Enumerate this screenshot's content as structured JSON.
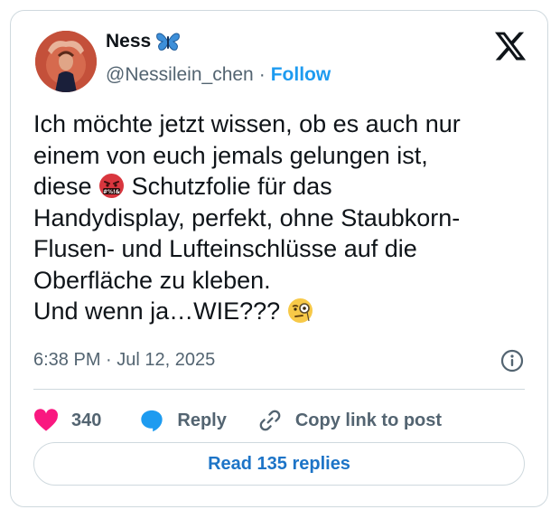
{
  "author": {
    "display_name": "Ness",
    "name_emoji": "butterfly-icon",
    "handle": "@Nessilein_chen",
    "separator": "·",
    "follow_label": "Follow"
  },
  "tweet": {
    "line1": "Ich möchte jetzt wissen, ob es auch nur\neinem von euch jemals gelungen ist,\ndiese ",
    "line2": " Schutzfolie für das\nHandydisplay, perfekt, ohne Staubkorn-\nFlusen- und Lufteinschlüsse auf die\nOberfläche zu kleben.\nUnd wenn ja…WIE??? ",
    "emoji_1": "cursing-face-emoji",
    "emoji_1_text": "#%!&",
    "emoji_2": "face-with-monocle-emoji",
    "timestamp": "6:38 PM · Jul 12, 2025"
  },
  "actions": {
    "likes": "340",
    "reply_label": "Reply",
    "copy_label": "Copy link to post"
  },
  "read_replies_label": "Read 135 replies",
  "colors": {
    "accent": "#1d9bf0",
    "like": "#f91880",
    "border": "#cfd9de",
    "text": "#0f1419",
    "muted": "#536471"
  }
}
